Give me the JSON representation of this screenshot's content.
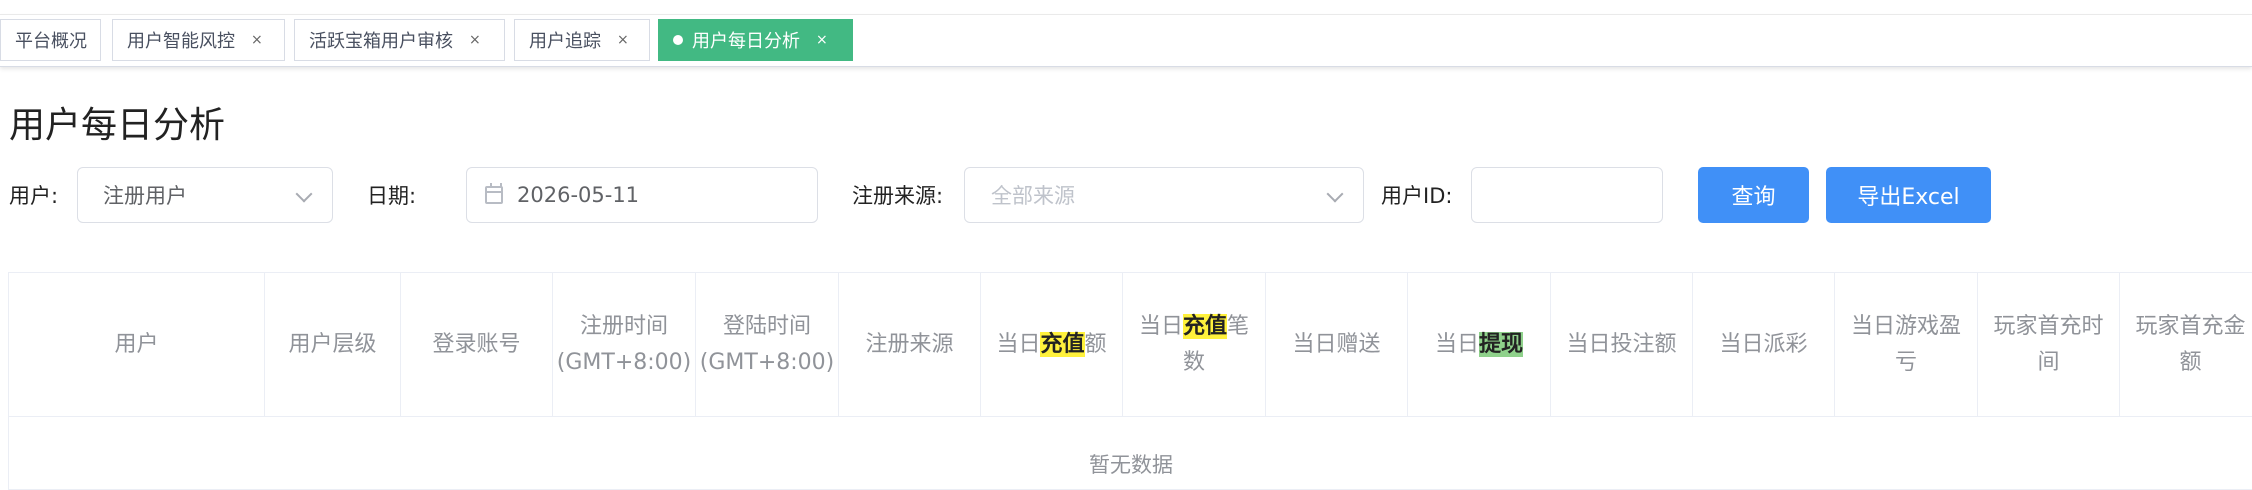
{
  "tabs": [
    {
      "label": "平台概况",
      "closable": false,
      "active": false
    },
    {
      "label": "用户智能风控",
      "closable": true,
      "active": false
    },
    {
      "label": "活跃宝箱用户审核",
      "closable": true,
      "active": false
    },
    {
      "label": "用户追踪",
      "closable": true,
      "active": false
    },
    {
      "label": "用户每日分析",
      "closable": true,
      "active": true
    }
  ],
  "tab_close_glyph": "×",
  "page_title": "用户每日分析",
  "filters": {
    "user_label": "用户:",
    "user_value": "注册用户",
    "date_label": "日期:",
    "date_value": "2026-05-11",
    "source_label": "注册来源:",
    "source_placeholder": "全部来源",
    "userid_label": "用户ID:",
    "userid_value": ""
  },
  "buttons": {
    "query": "查询",
    "export": "导出Excel"
  },
  "columns": {
    "user": "用户",
    "level": "用户层级",
    "account": "登录账号",
    "reg_time": "注册时间(GMT+8:00)",
    "login_time": "登陆时间(GMT+8:00)",
    "reg_source": "注册来源",
    "recharge_amount": {
      "pre": "当日",
      "hl": "充值",
      "post": "额"
    },
    "recharge_count": {
      "pre": "当日",
      "hl": "充值",
      "post": "笔数"
    },
    "gift": "当日赠送",
    "withdraw": {
      "pre": "当日",
      "hl": "提现",
      "post": ""
    },
    "bet_amount": "当日投注额",
    "payout": "当日派彩",
    "game_pnl": "当日游戏盈亏",
    "first_recharge_time": "玩家首充时间",
    "first_recharge_amount": "玩家首充金额"
  },
  "empty_text": "暂无数据",
  "colors": {
    "accent_blue": "#4090f7",
    "active_tab": "#42b983",
    "highlight_yellow": "#fff13c",
    "highlight_green": "#8fd18b"
  }
}
